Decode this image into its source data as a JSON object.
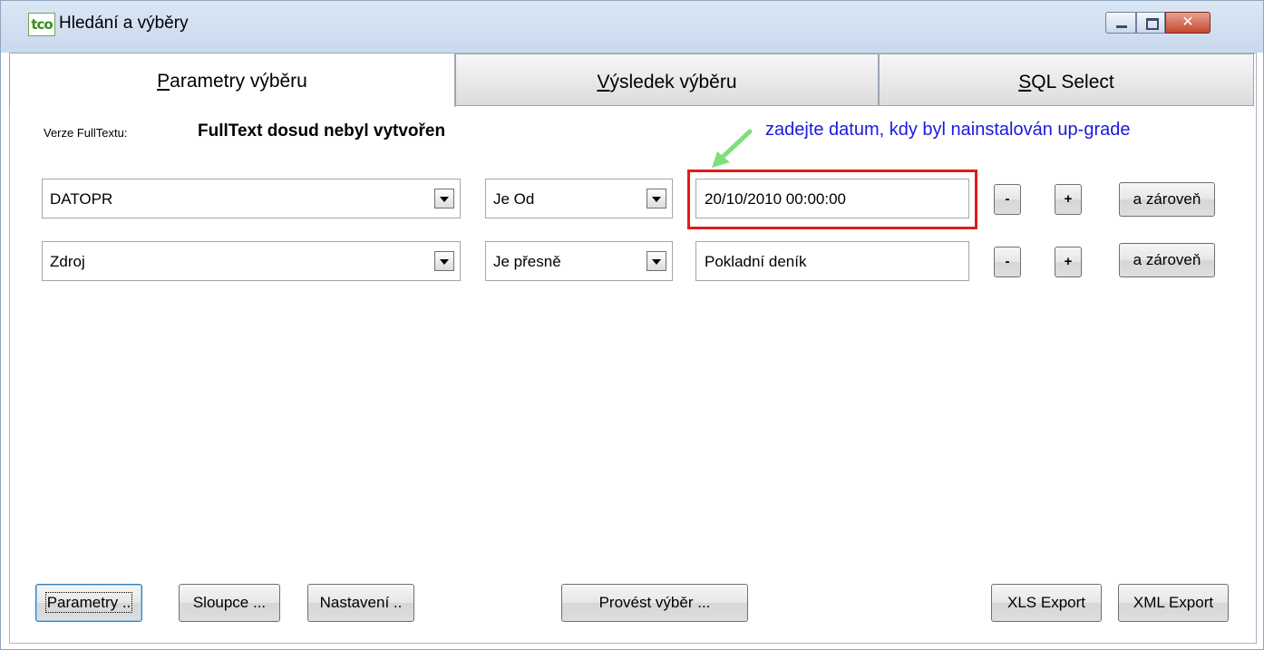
{
  "window": {
    "app_logo": "tco",
    "title": "Hledání a výběry"
  },
  "tabs": [
    {
      "prefix": "",
      "accel": "P",
      "rest": "arametry výběru",
      "active": true
    },
    {
      "prefix": "",
      "accel": "V",
      "rest": "ýsledek výběru",
      "active": false
    },
    {
      "prefix": "",
      "accel": "S",
      "rest": "QL Select",
      "active": false
    }
  ],
  "fulltext": {
    "label": "Verze FullTextu:",
    "value": "FullText dosud nebyl vytvořen"
  },
  "annotation": {
    "hint": "zadejte datum, kdy byl nainstalován up-grade",
    "highlight_color": "#e21b1b",
    "arrow_color": "#7fe07a"
  },
  "rows": [
    {
      "field": "DATOPR",
      "operator": "Je Od",
      "value": "20/10/2010 00:00:00",
      "minus": "-",
      "plus": "+",
      "and": "a zároveň"
    },
    {
      "field": "Zdroj",
      "operator": "Je přesně",
      "value": "Pokladní deník",
      "minus": "-",
      "plus": "+",
      "and": "a zároveň"
    }
  ],
  "bottom_buttons": {
    "parametry": "Parametry ..",
    "sloupce": "Sloupce ...",
    "nastaveni": "Nastavení ..",
    "provest": "Provést výběr ...",
    "xls": "XLS Export",
    "xml": "XML Export"
  }
}
